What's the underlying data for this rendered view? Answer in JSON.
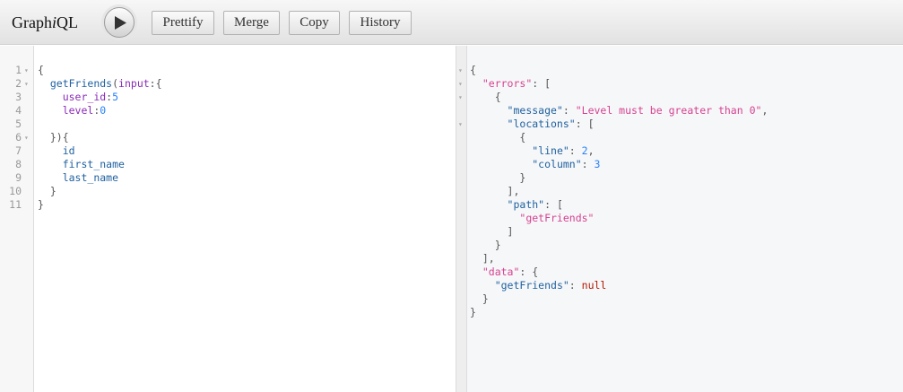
{
  "app": {
    "title_prefix": "Graph",
    "title_italic": "i",
    "title_suffix": "QL"
  },
  "toolbar": {
    "execute_icon": "play-icon",
    "buttons": [
      "Prettify",
      "Merge",
      "Copy",
      "History"
    ]
  },
  "query": {
    "line_numbers": [
      "1",
      "2",
      "3",
      "4",
      "5",
      "6",
      "7",
      "8",
      "9",
      "10",
      "11"
    ],
    "lines": [
      [
        {
          "t": "{",
          "c": "punc"
        }
      ],
      [
        {
          "t": "  ",
          "c": ""
        },
        {
          "t": "getFriends",
          "c": "def"
        },
        {
          "t": "(",
          "c": "punc"
        },
        {
          "t": "input",
          "c": "arg"
        },
        {
          "t": ":{",
          "c": "punc"
        }
      ],
      [
        {
          "t": "    ",
          "c": ""
        },
        {
          "t": "user_id",
          "c": "arg"
        },
        {
          "t": ":",
          "c": "punc"
        },
        {
          "t": "5",
          "c": "num"
        }
      ],
      [
        {
          "t": "    ",
          "c": ""
        },
        {
          "t": "level",
          "c": "arg"
        },
        {
          "t": ":",
          "c": "punc"
        },
        {
          "t": "0",
          "c": "num"
        }
      ],
      [
        {
          "t": "",
          "c": ""
        }
      ],
      [
        {
          "t": "  ",
          "c": ""
        },
        {
          "t": "}){",
          "c": "punc"
        }
      ],
      [
        {
          "t": "    ",
          "c": ""
        },
        {
          "t": "id",
          "c": "prop"
        }
      ],
      [
        {
          "t": "    ",
          "c": ""
        },
        {
          "t": "first_name",
          "c": "prop"
        }
      ],
      [
        {
          "t": "    ",
          "c": ""
        },
        {
          "t": "last_name",
          "c": "prop"
        }
      ],
      [
        {
          "t": "  ",
          "c": ""
        },
        {
          "t": "}",
          "c": "punc"
        }
      ],
      [
        {
          "t": "}",
          "c": "punc"
        }
      ]
    ]
  },
  "result": {
    "lines": [
      [
        {
          "t": "{",
          "c": "punc"
        }
      ],
      [
        {
          "t": "  ",
          "c": ""
        },
        {
          "t": "\"errors\"",
          "c": "str"
        },
        {
          "t": ": [",
          "c": "punc"
        }
      ],
      [
        {
          "t": "    ",
          "c": ""
        },
        {
          "t": "{",
          "c": "punc"
        }
      ],
      [
        {
          "t": "      ",
          "c": ""
        },
        {
          "t": "\"message\"",
          "c": "key"
        },
        {
          "t": ": ",
          "c": "punc"
        },
        {
          "t": "\"Level must be greater than 0\"",
          "c": "str"
        },
        {
          "t": ",",
          "c": "punc"
        }
      ],
      [
        {
          "t": "      ",
          "c": ""
        },
        {
          "t": "\"locations\"",
          "c": "key"
        },
        {
          "t": ": [",
          "c": "punc"
        }
      ],
      [
        {
          "t": "        ",
          "c": ""
        },
        {
          "t": "{",
          "c": "punc"
        }
      ],
      [
        {
          "t": "          ",
          "c": ""
        },
        {
          "t": "\"line\"",
          "c": "key"
        },
        {
          "t": ": ",
          "c": "punc"
        },
        {
          "t": "2",
          "c": "num"
        },
        {
          "t": ",",
          "c": "punc"
        }
      ],
      [
        {
          "t": "          ",
          "c": ""
        },
        {
          "t": "\"column\"",
          "c": "key"
        },
        {
          "t": ": ",
          "c": "punc"
        },
        {
          "t": "3",
          "c": "num"
        }
      ],
      [
        {
          "t": "        ",
          "c": ""
        },
        {
          "t": "}",
          "c": "punc"
        }
      ],
      [
        {
          "t": "      ",
          "c": ""
        },
        {
          "t": "],",
          "c": "punc"
        }
      ],
      [
        {
          "t": "      ",
          "c": ""
        },
        {
          "t": "\"path\"",
          "c": "key"
        },
        {
          "t": ": [",
          "c": "punc"
        }
      ],
      [
        {
          "t": "        ",
          "c": ""
        },
        {
          "t": "\"getFriends\"",
          "c": "str"
        }
      ],
      [
        {
          "t": "      ",
          "c": ""
        },
        {
          "t": "]",
          "c": "punc"
        }
      ],
      [
        {
          "t": "    ",
          "c": ""
        },
        {
          "t": "}",
          "c": "punc"
        }
      ],
      [
        {
          "t": "  ",
          "c": ""
        },
        {
          "t": "],",
          "c": "punc"
        }
      ],
      [
        {
          "t": "  ",
          "c": ""
        },
        {
          "t": "\"data\"",
          "c": "str"
        },
        {
          "t": ": {",
          "c": "punc"
        }
      ],
      [
        {
          "t": "    ",
          "c": ""
        },
        {
          "t": "\"getFriends\"",
          "c": "key"
        },
        {
          "t": ": ",
          "c": "punc"
        },
        {
          "t": "null",
          "c": "kw"
        }
      ],
      [
        {
          "t": "  ",
          "c": ""
        },
        {
          "t": "}",
          "c": "punc"
        }
      ],
      [
        {
          "t": "}",
          "c": "punc"
        }
      ]
    ]
  },
  "colors": {
    "string": "#d64292",
    "key": "#1f61a0",
    "argument": "#8b2bb9",
    "number": "#2882f9",
    "keyword": "#b11a04"
  }
}
